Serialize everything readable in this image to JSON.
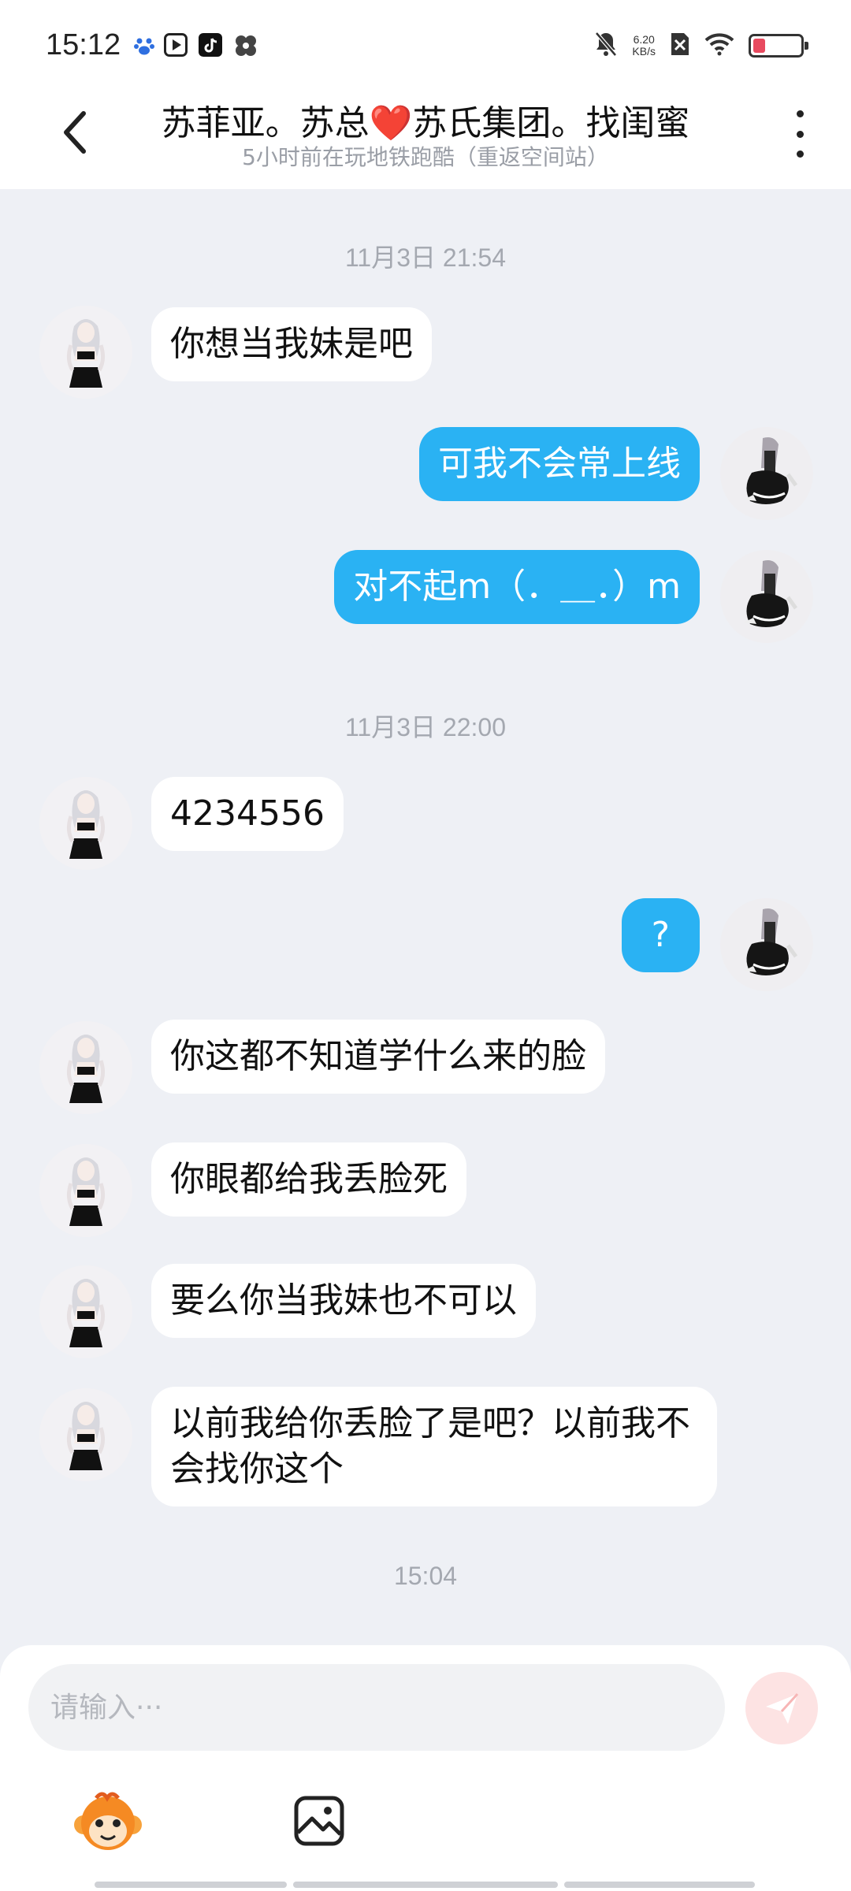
{
  "status_bar": {
    "time": "15:12",
    "net_speed_value": "6.20",
    "net_speed_unit": "KB/s",
    "battery_level": 0.25,
    "battery_color": "#e84a5f",
    "icons": [
      "baidu-icon",
      "video-app-icon",
      "tiktok-icon",
      "pinwheel-app-icon",
      "mute-icon",
      "sim-off-icon",
      "wifi-icon",
      "battery-icon"
    ]
  },
  "header": {
    "title": "苏菲亚。苏总❤️苏氏集团。找闺蜜",
    "subtitle": "5小时前在玩地铁跑酷（重返空间站）"
  },
  "timestamps": [
    "11月3日 21:54",
    "11月3日 22:00",
    "15:04"
  ],
  "messages": [
    {
      "side": "in",
      "text": "你想当我妹是吧"
    },
    {
      "side": "out",
      "text": "可我不会常上线"
    },
    {
      "side": "out",
      "text": "对不起m（．＿．）m"
    },
    {
      "side": "in",
      "text": "4234556"
    },
    {
      "side": "out",
      "text": "?"
    },
    {
      "side": "in",
      "text": "你这都不知道学什么来的脸"
    },
    {
      "side": "in",
      "text": "你眼都给我丢脸死"
    },
    {
      "side": "in",
      "text": "要么你当我妹也不可以"
    },
    {
      "side": "in",
      "text": "以前我给你丢脸了是吧？以前我不会找你这个"
    }
  ],
  "input": {
    "placeholder": "请输入···"
  },
  "colors": {
    "outgoing_bubble": "#2ab2f3",
    "incoming_bubble": "#ffffff",
    "chat_background": "#eef0f5",
    "send_button": "#fde3e3"
  }
}
